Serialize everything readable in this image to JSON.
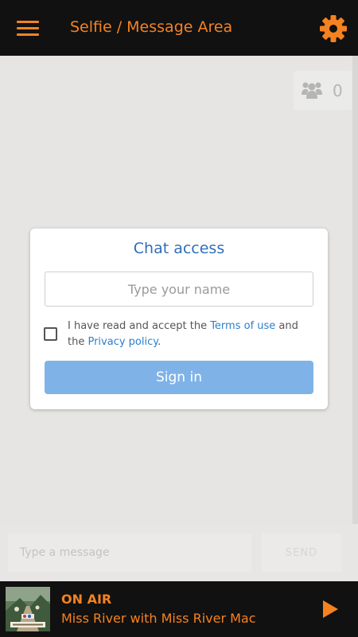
{
  "header": {
    "title": "Selfie / Message Area",
    "menu_icon": "hamburger-menu-icon",
    "settings_icon": "gear-icon",
    "accent_color": "#f58220",
    "background_color": "#111111"
  },
  "chat": {
    "online_users_icon": "users-icon",
    "online_count": "0"
  },
  "access_dialog": {
    "title": "Chat access",
    "name_placeholder": "Type your name",
    "terms_checked": false,
    "terms_prefix": "I have read and accept the ",
    "terms_link": "Terms of use",
    "terms_middle": " and the ",
    "privacy_link": "Privacy policy",
    "terms_suffix": ".",
    "signin_label": "Sign in",
    "title_color": "#2f6fb7",
    "button_color": "#7fb3e8"
  },
  "composer": {
    "message_placeholder": "Type a message",
    "send_label": "SEND"
  },
  "player": {
    "status": "ON AIR",
    "show": "Miss River with Miss River Mac",
    "play_icon": "play-icon"
  }
}
